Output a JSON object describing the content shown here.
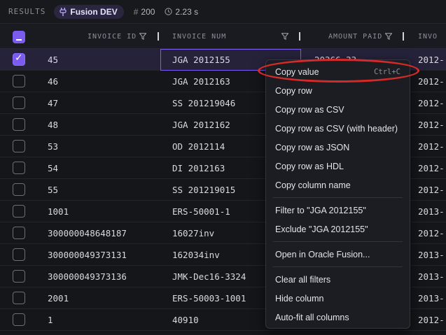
{
  "topbar": {
    "results_label": "RESULTS",
    "env_name": "Fusion DEV",
    "row_count": "200",
    "elapsed": "2.23 s"
  },
  "columns": [
    {
      "label": "INVOICE ID"
    },
    {
      "label": "INVOICE NUM"
    },
    {
      "label": "AMOUNT PAID"
    },
    {
      "label": "INVO"
    }
  ],
  "rows": [
    {
      "id": "45",
      "num": "JGA 2012155",
      "amount": "20366.33",
      "date": "2012-",
      "checked": true
    },
    {
      "id": "46",
      "num": "JGA 2012163",
      "amount": "",
      "date": "2012-"
    },
    {
      "id": "47",
      "num": "SS 201219046",
      "amount": "",
      "date": "2012-"
    },
    {
      "id": "48",
      "num": "JGA 2012162",
      "amount": "",
      "date": "2012-"
    },
    {
      "id": "53",
      "num": "OD 2012114",
      "amount": "",
      "date": "2012-"
    },
    {
      "id": "54",
      "num": "DI 2012163",
      "amount": "",
      "date": "2012-"
    },
    {
      "id": "55",
      "num": "SS 201219015",
      "amount": "",
      "date": "2012-"
    },
    {
      "id": "1001",
      "num": "ERS-50001-1",
      "amount": "",
      "date": "2013-"
    },
    {
      "id": "300000048648187",
      "num": "16027inv",
      "amount": "",
      "date": "2012-"
    },
    {
      "id": "300000049373131",
      "num": "162034inv",
      "amount": "",
      "date": "2013-"
    },
    {
      "id": "300000049373136",
      "num": "JMK-Dec16-3324",
      "amount": "",
      "date": "2013-"
    },
    {
      "id": "2001",
      "num": "ERS-50003-1001",
      "amount": "",
      "date": "2013-"
    },
    {
      "id": "1",
      "num": "40910",
      "amount": "",
      "date": "2012-"
    }
  ],
  "context_menu": {
    "items": [
      {
        "label": "Copy value",
        "shortcut": "Ctrl+C"
      },
      {
        "label": "Copy row"
      },
      {
        "label": "Copy row as CSV"
      },
      {
        "label": "Copy row as CSV (with header)"
      },
      {
        "label": "Copy row as JSON"
      },
      {
        "label": "Copy row as HDL"
      },
      {
        "label": "Copy column name"
      },
      {
        "label": "Filter to \"JGA 2012155\""
      },
      {
        "label": "Exclude \"JGA 2012155\""
      },
      {
        "label": "Open in Oracle Fusion..."
      },
      {
        "label": "Clear all filters"
      },
      {
        "label": "Hide column"
      },
      {
        "label": "Auto-fit all columns"
      }
    ]
  },
  "colors": {
    "accent": "#7c5cf0",
    "highlight_ring": "#d42a2a",
    "background": "#15161a"
  },
  "icons": [
    "plug-icon",
    "hash-icon",
    "clock-icon",
    "filter-funnel-icon",
    "checkmark-icon"
  ]
}
